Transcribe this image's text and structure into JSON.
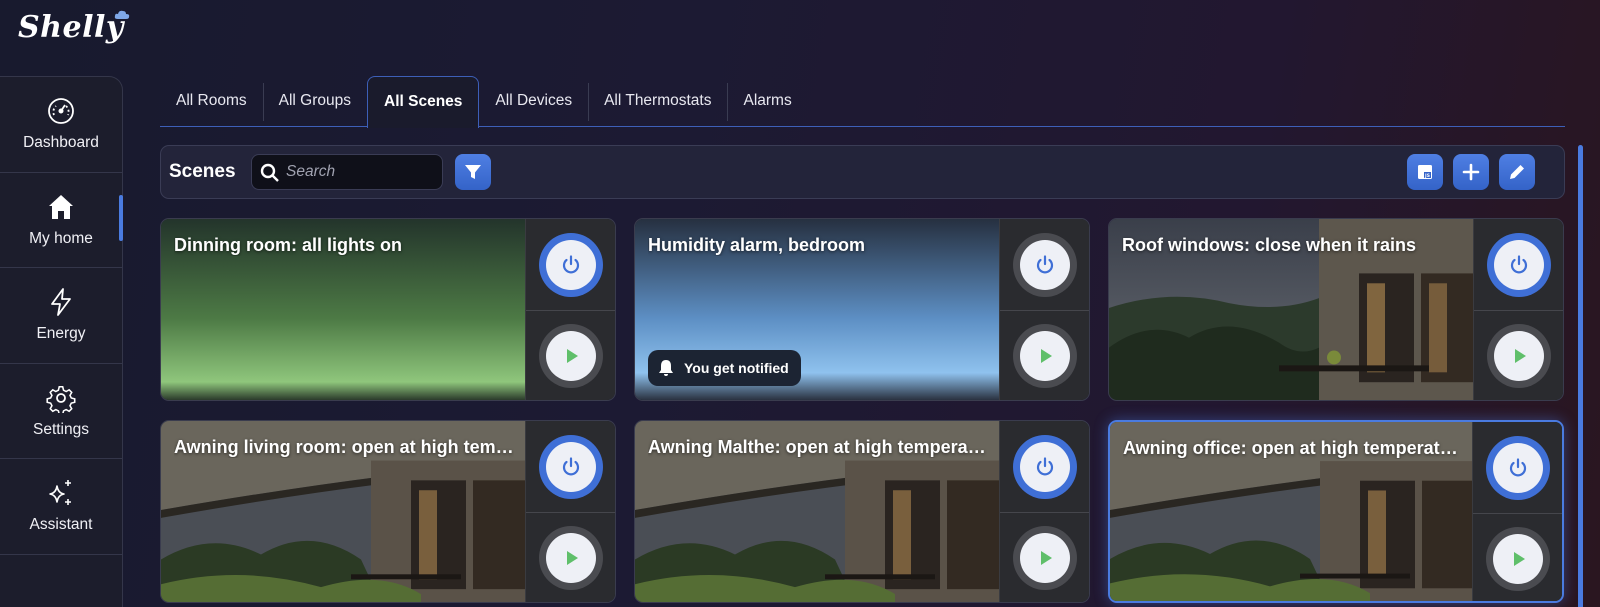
{
  "brand": {
    "logo_text": "Shelly"
  },
  "sidebar": {
    "items": [
      {
        "label": "Dashboard",
        "icon": "gauge-icon"
      },
      {
        "label": "My home",
        "icon": "home-icon",
        "active": true
      },
      {
        "label": "Energy",
        "icon": "lightning-icon"
      },
      {
        "label": "Settings",
        "icon": "gear-icon"
      },
      {
        "label": "Assistant",
        "icon": "sparkle-icon"
      }
    ]
  },
  "tabs": [
    {
      "label": "All Rooms"
    },
    {
      "label": "All Groups"
    },
    {
      "label": "All Scenes",
      "active": true
    },
    {
      "label": "All Devices"
    },
    {
      "label": "All Thermostats"
    },
    {
      "label": "Alarms"
    }
  ],
  "toolbar": {
    "title": "Scenes",
    "search_placeholder": "Search",
    "script_button_icon": "js-file-icon",
    "add_button_icon": "plus-icon",
    "edit_button_icon": "pencil-icon"
  },
  "scenes": [
    {
      "name": "Dinning room: all lights on",
      "power_on": true,
      "background": "green-gradient"
    },
    {
      "name": "Humidity alarm, bedroom",
      "power_on": false,
      "background": "blue-gradient",
      "badge": "You get notified"
    },
    {
      "name": "Roof windows: close when it rains",
      "power_on": true,
      "background": "house-dusk"
    },
    {
      "name": "Awning living room: open at high temperature",
      "power_on": true,
      "background": "awning-terrace"
    },
    {
      "name": "Awning Malthe: open at high temperature",
      "power_on": true,
      "background": "awning-terrace"
    },
    {
      "name": "Awning office: open at high temperature",
      "power_on": true,
      "background": "awning-terrace",
      "selected": true
    }
  ],
  "colors": {
    "accent": "#4a7be0",
    "power_on_ring": "#3f6fd6",
    "play_arrow": "#5fbf6a",
    "panel": "#2a2b2f"
  }
}
